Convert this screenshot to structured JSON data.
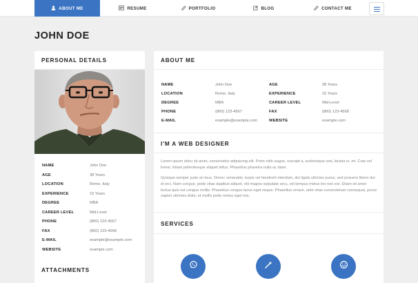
{
  "nav": {
    "items": [
      {
        "label": "ABOUT ME",
        "icon": "user-icon"
      },
      {
        "label": "RESUME",
        "icon": "resume-icon"
      },
      {
        "label": "PORTFOLIO",
        "icon": "pencil-icon"
      },
      {
        "label": "BLOG",
        "icon": "edit-icon"
      },
      {
        "label": "CONTACT ME",
        "icon": "pencil-icon"
      }
    ],
    "menu_icon": "hamburger-menu-icon",
    "accent": "#3a74c2"
  },
  "page": {
    "title": "JOHN DOE"
  },
  "personal": {
    "heading": "PERSONAL DETAILS",
    "rows": [
      {
        "label": "NAME",
        "value": "John Doe"
      },
      {
        "label": "AGE",
        "value": "38 Years"
      },
      {
        "label": "LOCATION",
        "value": "Rome, Italy"
      },
      {
        "label": "EXPERIENCE",
        "value": "15 Years"
      },
      {
        "label": "DEGREE",
        "value": "MBA"
      },
      {
        "label": "CAREER LEVEL",
        "value": "Mid-Level"
      },
      {
        "label": "PHONE",
        "value": "(800) 123-4567"
      },
      {
        "label": "FAX",
        "value": "(800) 123-4568"
      },
      {
        "label": "E-MAIL",
        "value": "example@example.com"
      },
      {
        "label": "WEBSITE",
        "value": "example.com"
      }
    ]
  },
  "attachments": {
    "heading": "ATTACHMENTS"
  },
  "about": {
    "heading": "ABOUT ME",
    "left": [
      {
        "label": "NAME",
        "value": "John Doe"
      },
      {
        "label": "LOCATION",
        "value": "Rome, Italy"
      },
      {
        "label": "DEGREE",
        "value": "MBA"
      },
      {
        "label": "PHONE",
        "value": "(800) 123-4567"
      },
      {
        "label": "E-MAIL",
        "value": "example@example.com"
      }
    ],
    "right": [
      {
        "label": "AGE",
        "value": "38 Years"
      },
      {
        "label": "EXPERIENCE",
        "value": "15 Years"
      },
      {
        "label": "CAREER LEVEL",
        "value": "Mid-Level"
      },
      {
        "label": "FAX",
        "value": "(800) 123-4568"
      },
      {
        "label": "WEBSITE",
        "value": "example.com"
      }
    ],
    "designer_heading": "I'M A WEB DESIGNER",
    "paragraphs": [
      "Lorem ipsum dolor sit amet, consectetur adipiscing elit. Proin nibh augue, suscipit a, scelerisque sed, lacinia in, mi. Cras vel lorem. Etiam pellentesque aliquet tellus. Phasellus pharetra nulla ac diam.",
      "Quisque semper justo at risus. Donec venenatis, turpis vel hendrerit interdum, dui ligula ultricies purus, sed posuere libero dui id orci. Nam congue, pede vitae dapibus aliquet, elit magna vulputate arcu, vel tempus metus leo non est. Etiam sit amet lectus quis est congue mollis. Phasellus congue lacus eget neque. Phasellus ornare, ante vitae consectetuer consequat, purus sapien ultricies dolor, et mollis pede metus eget nisi."
    ],
    "services_heading": "SERVICES",
    "services": [
      {
        "icon": "whatsapp-icon"
      },
      {
        "icon": "magic-wand-icon"
      },
      {
        "icon": "smiley-icon"
      }
    ]
  }
}
